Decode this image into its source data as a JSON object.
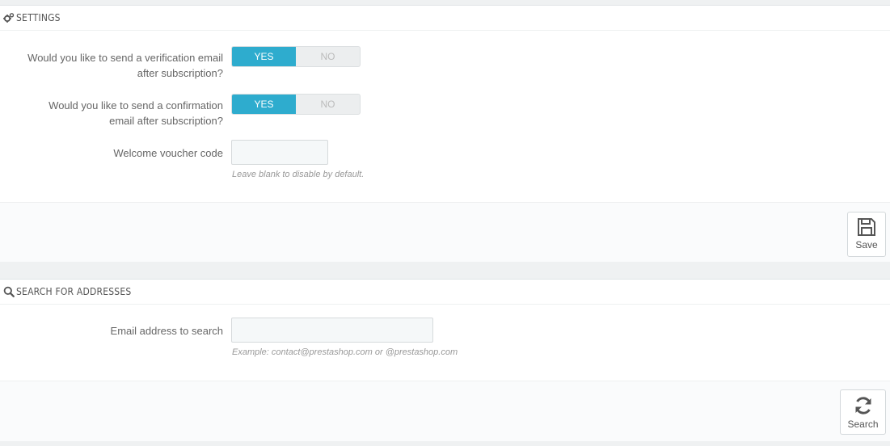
{
  "settings": {
    "title": "SETTINGS",
    "verification": {
      "label_line1": "Would you like to send a verification email",
      "label_line2": "after subscription?",
      "yes": "YES",
      "no": "NO"
    },
    "confirmation": {
      "label_line1": "Would you like to send a confirmation",
      "label_line2": "email after subscription?",
      "yes": "YES",
      "no": "NO"
    },
    "voucher": {
      "label": "Welcome voucher code",
      "value": "",
      "help": "Leave blank to disable by default."
    },
    "save_label": "Save"
  },
  "search": {
    "title": "SEARCH FOR ADDRESSES",
    "email": {
      "label": "Email address to search",
      "value": "",
      "help": "Example: contact@prestashop.com or @prestashop.com"
    },
    "search_label": "Search"
  },
  "colors": {
    "accent": "#2eacce"
  }
}
